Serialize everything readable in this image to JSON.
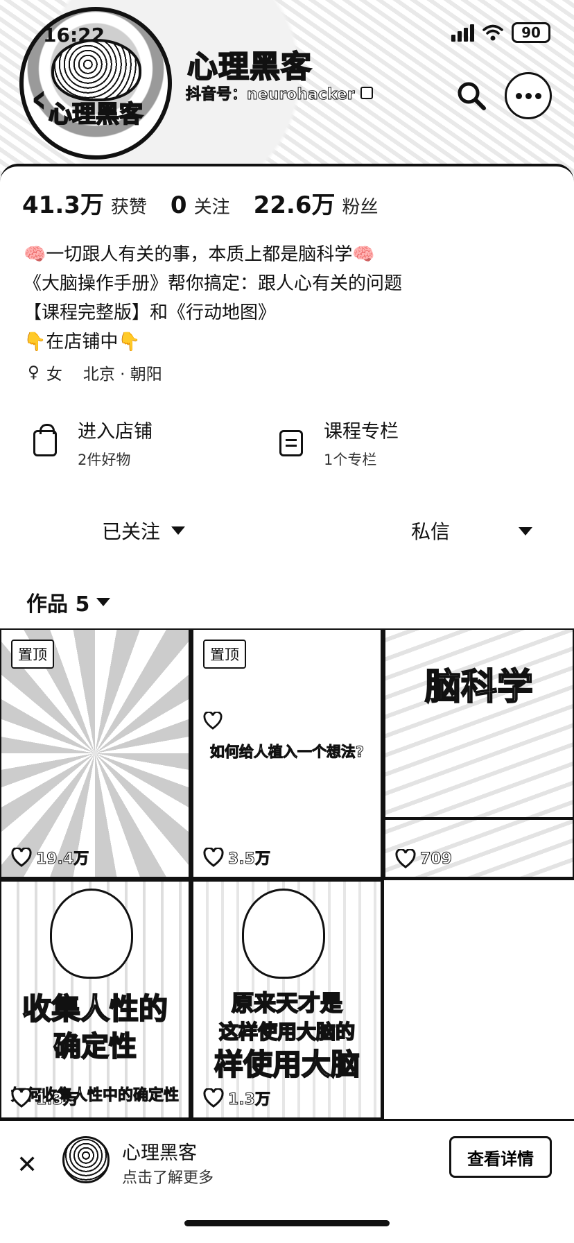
{
  "status_bar": {
    "time": "16:22",
    "battery": "90",
    "icons": [
      "signal-icon",
      "wifi-icon",
      "battery-icon"
    ]
  },
  "header": {
    "avatar_caption": "心理黑客",
    "name": "心理黑客",
    "douyin_id": "抖音号：neurohacker",
    "icons": [
      "back-icon",
      "copy-icon",
      "search-icon",
      "more-icon"
    ]
  },
  "stats": [
    {
      "value": "41.3万",
      "label": "获赞"
    },
    {
      "value": "0",
      "label": "关注"
    },
    {
      "value": "22.6万",
      "label": "粉丝"
    }
  ],
  "bio": [
    "🧠一切跟人有关的事，本质上都是脑科学🧠",
    "《大脑操作手册》帮你搞定：跟人心有关的问题",
    "【课程完整版】和《行动地图》",
    "👇在店铺中👇"
  ],
  "meta": {
    "gender": "女",
    "location": "北京 · 朝阳"
  },
  "services": [
    {
      "title": "进入店铺",
      "subtitle": "2件好物",
      "icon": "bag-icon"
    },
    {
      "title": "课程专栏",
      "subtitle": "1个专栏",
      "icon": "column-icon"
    }
  ],
  "actions": {
    "follow": "已关注",
    "message": "私信"
  },
  "works_tab": {
    "label": "作品 5"
  },
  "videos": [
    {
      "pinned": "置顶",
      "likes": "19.4万"
    },
    {
      "pinned": "置顶",
      "likes": "3.5万",
      "caption": "如何给人植入一个想法?"
    },
    {
      "likes": "709",
      "caption": "脑科学"
    },
    {
      "likes": "1.3万",
      "caption1": "收集人性的",
      "caption2": "确定性",
      "caption3": "如何收集人性中的确定性"
    },
    {
      "likes": "1.3万",
      "caption1": "原来天才是",
      "caption2": "这样使用大脑的",
      "caption3": "样使用大脑"
    }
  ],
  "bottom_bar": {
    "title": "心理黑客",
    "subtitle": "点击了解更多",
    "button": "查看详情"
  },
  "colors": {
    "primary": "#111111",
    "background": "#ffffff"
  }
}
